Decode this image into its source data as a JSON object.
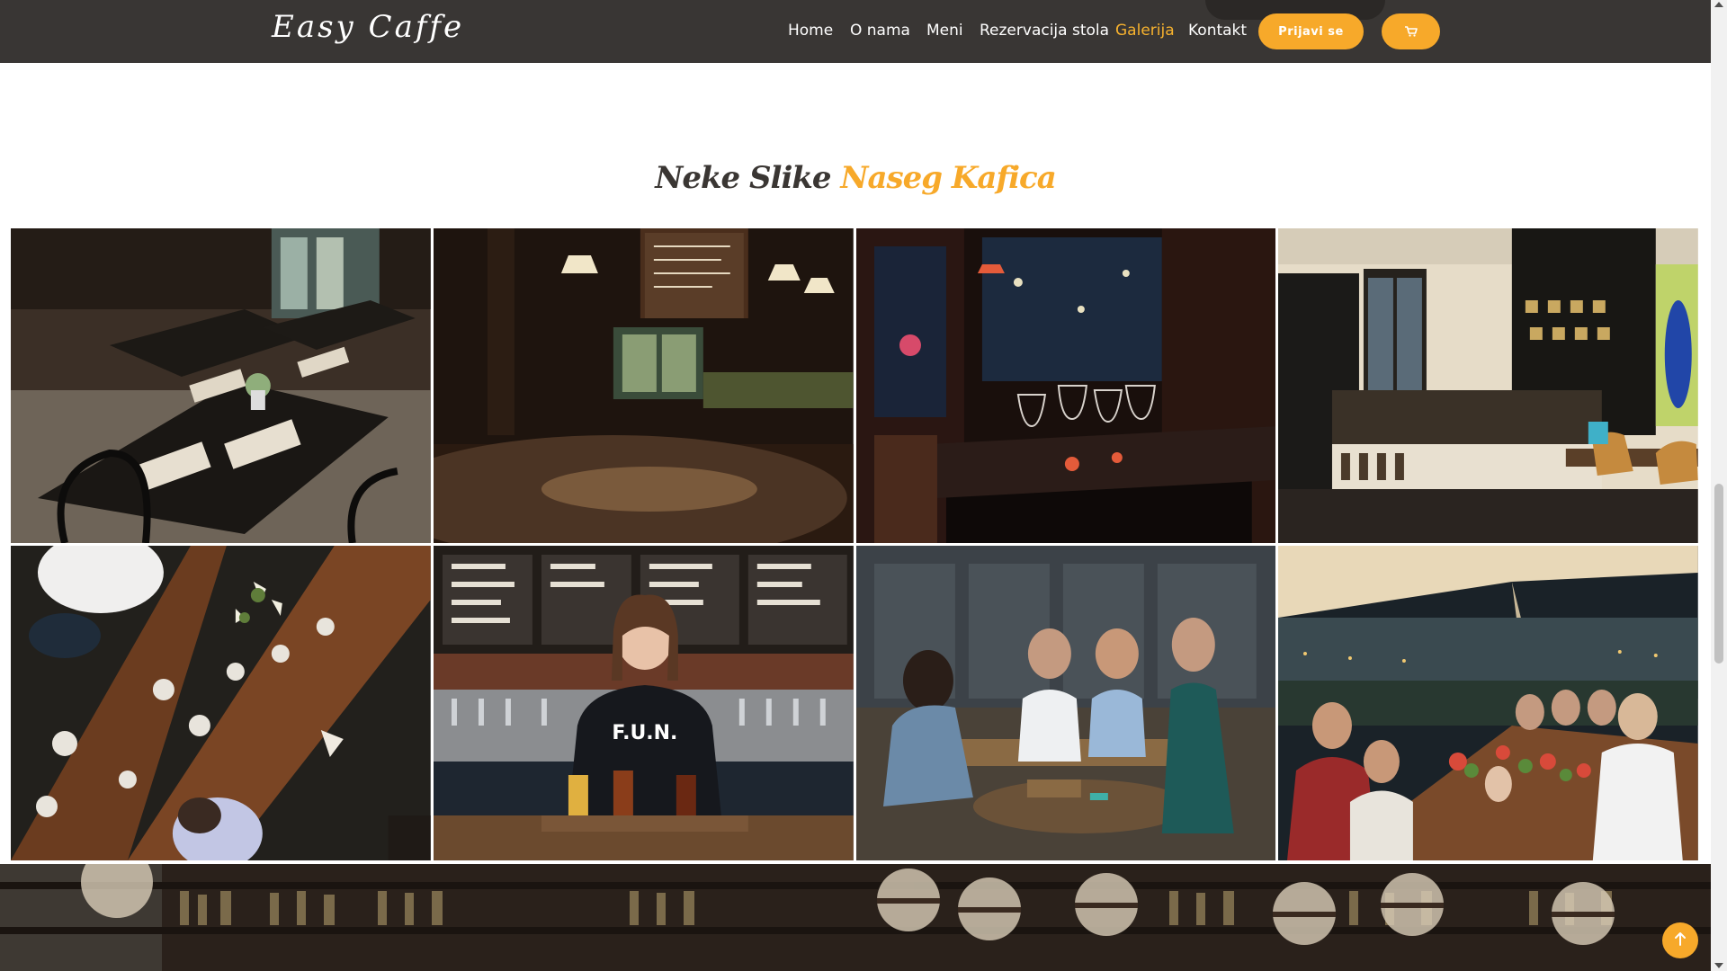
{
  "header": {
    "logo": "Easy Caffe",
    "nav": [
      {
        "label": "Home",
        "active": false
      },
      {
        "label": "O nama",
        "active": false
      },
      {
        "label": "Meni",
        "active": false
      },
      {
        "label": "Rezervacija stola",
        "active": false
      },
      {
        "label": "Galerija",
        "active": true
      },
      {
        "label": "Kontakt",
        "active": false
      }
    ],
    "login_label": "Prijavi se",
    "cart_icon": "cart-icon"
  },
  "gallery": {
    "title_part1": "Neke Slike",
    "title_part2": "Naseg Kafica",
    "photos": [
      {
        "name": "photo-cafe-tables"
      },
      {
        "name": "photo-dark-bar-interior"
      },
      {
        "name": "photo-wine-glasses-table"
      },
      {
        "name": "photo-bright-cafe-bar"
      },
      {
        "name": "photo-overhead-dining-table"
      },
      {
        "name": "photo-bartender-beer-flight"
      },
      {
        "name": "photo-friends-on-patio"
      },
      {
        "name": "photo-outdoor-dinner-toast"
      }
    ]
  },
  "colors": {
    "accent": "#f7a92a",
    "header_bg": "#393634",
    "title_dark": "#3a3633"
  },
  "back_to_top_icon": "arrow-up-icon"
}
